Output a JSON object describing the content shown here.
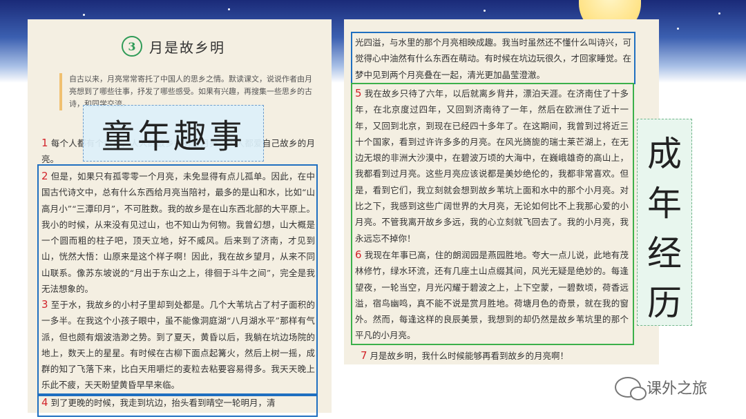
{
  "lesson": {
    "number": "3",
    "title": "月是故乡明"
  },
  "intro_text": "自古以来，月亮常常寄托了中国人的思乡之情。默读课文，说说作者由月亮想到了哪些往事，抒发了哪些感受。如果有兴趣，再搜集一些思乡的古诗，和同学交流。",
  "tag_left": "童年趣事",
  "tag_right": [
    "成",
    "年",
    "经",
    "历"
  ],
  "left_paragraphs": [
    {
      "num": "1",
      "text": "每个人都有个故乡，人人的故乡都有个月亮。人人都爱自己故乡的月亮。"
    },
    {
      "num": "2",
      "text": "但是，如果只有孤零零一个月亮，未免显得有点儿孤单。因此，在中国古代诗文中，总有什么东西给月亮当陪衬，最多的是山和水，比如“山高月小”“三潭印月”，不可胜数。我的故乡是在山东西北部的大平原上。我小的时候，从来没有见过山，也不知山为何物。我曾幻想，山大概是一个圆而粗的柱子吧，顶天立地，好不威风。后来到了济南，才见到山，恍然大悟：山原来是这个样子啊！因此，我在故乡望月，从来不同山联系。像苏东坡说的“月出于东山之上，徘徊于斗牛之间”，完全是我无法想象的。"
    },
    {
      "num": "3",
      "text": "至于水，我故乡的小村子里却到处都是。几个大苇坑占了村子面积的一多半。在我这个小孩子眼中，虽不能像洞庭湖“八月湖水平”那样有气派，但也颇有烟波浩渺之势。到了夏天，黄昏以后，我躺在坑边场院的地上，数天上的星星。有时候在古柳下面点起篝火，然后上树一摇，成群的知了飞落下来，比白天用嚼烂的麦粒去粘要容易得多。我天天晚上乐此不疲，天天盼望黄昏早早来临。"
    },
    {
      "num": "4",
      "text": "到了更晚的时候，我走到坑边，抬头看到晴空一轮明月，清"
    }
  ],
  "right_top_text": "光四溢，与水里的那个月亮相映成趣。我当时虽然还不懂什么叫诗兴，可觉得心中油然有什么东西在萌动。有时候在坑边玩很久，才回家睡觉。在梦中见到两个月亮叠在一起，清光更加晶莹澄澈。",
  "right_paragraphs": [
    {
      "num": "5",
      "text": "我在故乡只待了六年，以后就离乡背井，漂泊天涯。在济南住了十多年，在北京度过四年，又回到济南待了一年，然后在欧洲住了近十一年，又回到北京，到现在已经四十多年了。在这期间，我曾到过将近三十个国家，看到过许许多多的月亮。在风光旖旎的瑞士莱芒湖上，在无边无垠的非洲大沙漠中，在碧波万顷的大海中，在巍峨雄奇的高山上，我都看到过月亮。这些月亮应该说都是美妙绝伦的，我都非常喜欢。但是，看到它们，我立刻就会想到故乡苇坑上面和水中的那个小月亮。对比之下，我感到这些广阔世界的大月亮，无论如何比不上我那心爱的小月亮。不管我离开故乡多远，我的心立刻就飞回去了。我的小月亮，我永远忘不掉你！"
    },
    {
      "num": "6",
      "text": "我现在年事已高，住的朗润园是燕园胜地。夸大一点儿说，此地有茂林修竹，绿水环流，还有几座土山点缀其间，风光无疑是绝妙的。每逢望夜，一轮当空，月光闪耀于碧波之上，上下空蒙，一碧数顷，荷香远溢，宿鸟幽鸣，真不能不说是赏月胜地。荷塘月色的奇景，就在我的窗外。然而，每逢这样的良辰美景，我想到的却仍然是故乡苇坑里的那个平凡的小月亮。"
    },
    {
      "num": "7",
      "text": "月是故乡明，我什么时候能够再看到故乡的月亮啊！"
    }
  ],
  "watermark_text": "课外之旅"
}
